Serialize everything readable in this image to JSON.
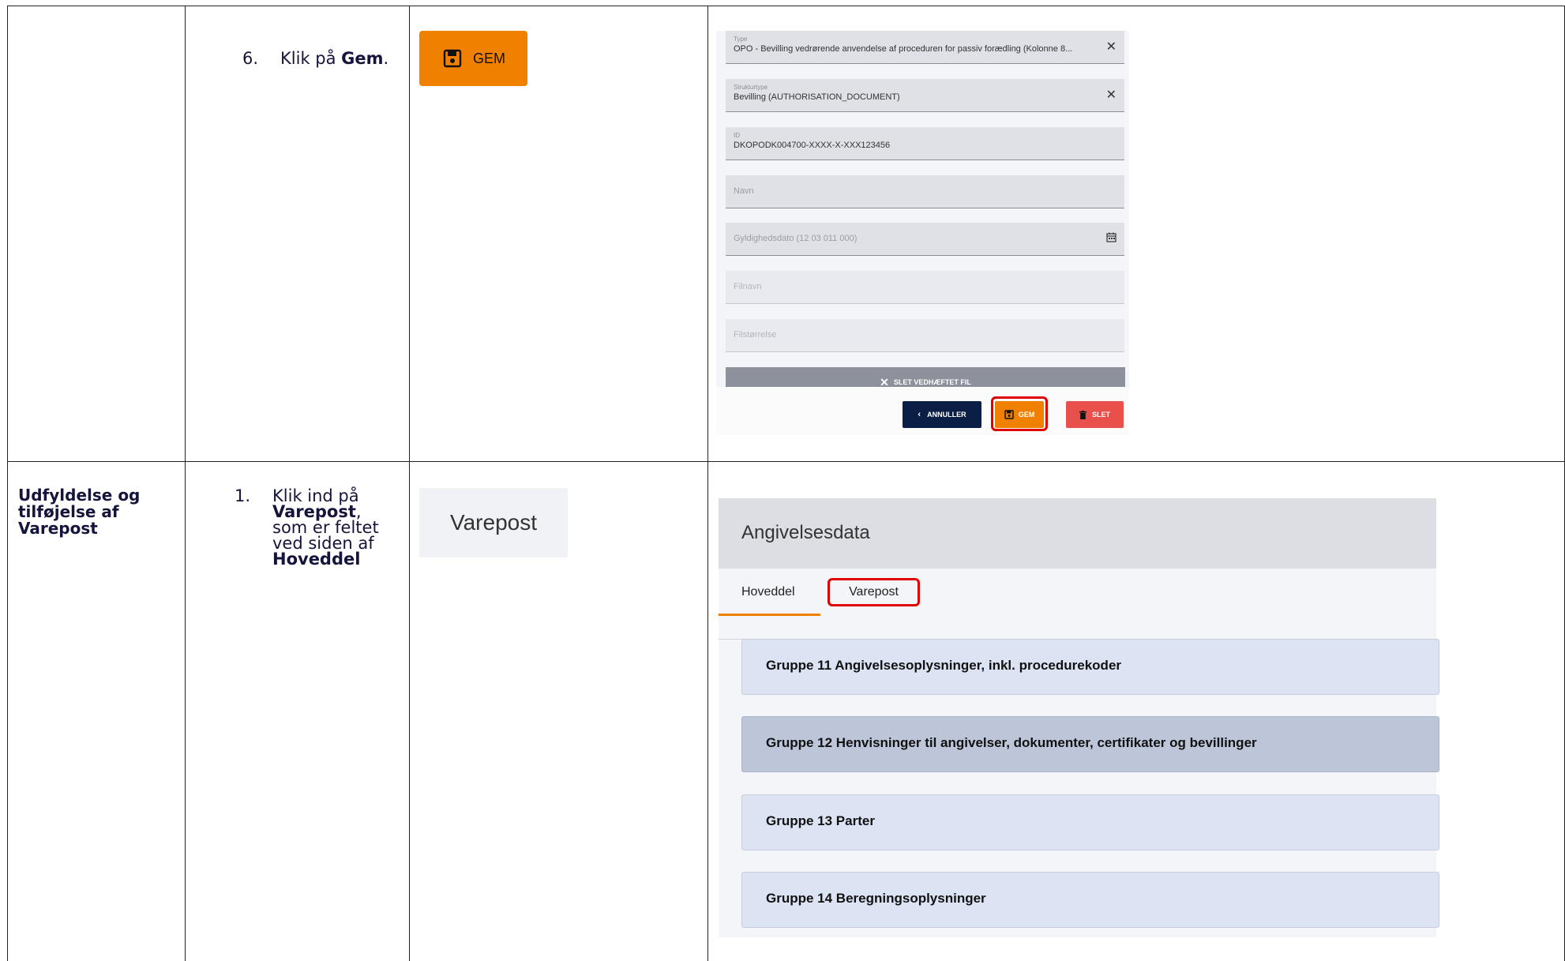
{
  "row1": {
    "step_number": "6.",
    "step_prefix": "Klik på ",
    "step_bold": "Gem",
    "step_suffix": ".",
    "gem_button_label": "GEM",
    "form": {
      "fields": [
        {
          "label": "Type",
          "value": "OPO - Bevilling vedrørende anvendelse af proceduren for passiv forædling (Kolonne 8..."
        },
        {
          "label": "Strukturtype",
          "value": "Bevilling (AUTHORISATION_DOCUMENT)"
        },
        {
          "label": "ID",
          "value": "DKOPODK004700-XXXX-X-XXX123456"
        },
        {
          "placeholder": "Navn"
        },
        {
          "placeholder": "Gyldighedsdato (12 03 011 000)"
        },
        {
          "placeholder": "Filnavn"
        },
        {
          "placeholder": "Filstørrelse"
        }
      ],
      "remove_attachment_label": "SLET VEDHÆFTET FIL",
      "cancel_label": "ANNULLER",
      "save_label": "GEM",
      "delete_label": "SLET"
    }
  },
  "row2": {
    "section_heading": "Udfyldelse og tilføjelse af Varepost",
    "step_number": "1.",
    "step_lines": [
      "Klik ind på",
      "Varepost",
      ",",
      "som er feltet",
      "ved siden af",
      "Hoveddel"
    ],
    "varepost_chip": "Varepost",
    "panel": {
      "title": "Angivelsesdata",
      "tabs": [
        "Hoveddel",
        "Varepost"
      ],
      "groups": [
        "Gruppe 11 Angivelsesoplysninger, inkl. procedurekoder",
        "Gruppe 12 Henvisninger til angivelser, dokumenter, certifikater og bevillinger",
        "Gruppe 13 Parter",
        "Gruppe 14 Beregningsoplysninger"
      ]
    }
  },
  "colors": {
    "orange": "#f08000",
    "navy": "#0a1e46",
    "red_button": "#e8504c",
    "highlight": "#e00000"
  }
}
